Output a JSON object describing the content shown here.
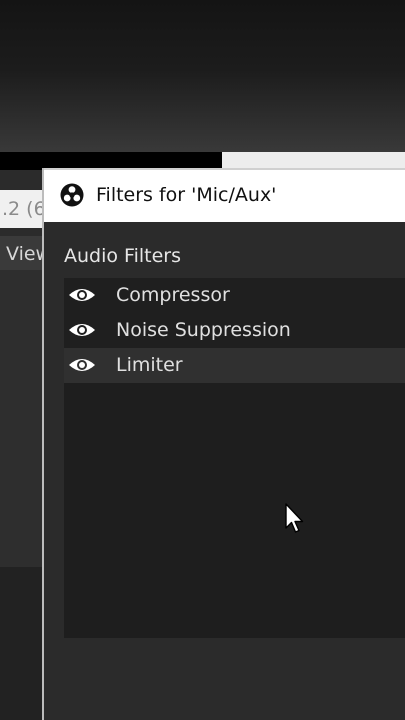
{
  "background": {
    "version_text": ".2 (6",
    "menu_text": "View"
  },
  "dialog": {
    "title": "Filters for 'Mic/Aux'",
    "section_label": "Audio Filters",
    "filters": [
      {
        "name": "Compressor",
        "visible": true,
        "selected": false
      },
      {
        "name": "Noise Suppression",
        "visible": true,
        "selected": false
      },
      {
        "name": "Limiter",
        "visible": true,
        "selected": true
      }
    ]
  },
  "icons": {
    "app": "obs-logo-icon",
    "visibility": "eye-icon",
    "pointer": "mouse-cursor-icon"
  },
  "colors": {
    "dialog_bg": "#2b2b2b",
    "list_bg": "#1e1e1e",
    "selected_row": "#303030",
    "titlebar": "#ffffff"
  }
}
